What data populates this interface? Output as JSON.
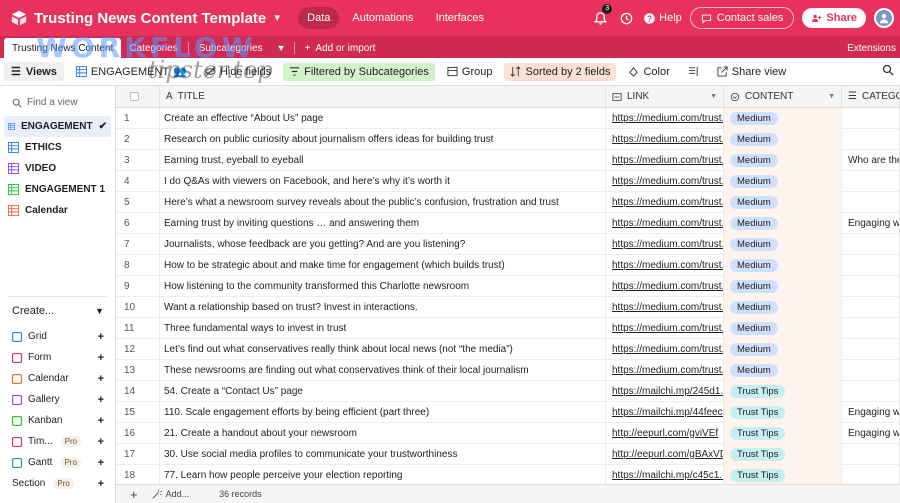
{
  "header": {
    "base_title": "Trusting News Content Template",
    "nav": [
      "Data",
      "Automations",
      "Interfaces"
    ],
    "notification_count": "3",
    "help_label": "Help",
    "contact_label": "Contact sales",
    "share_label": "Share"
  },
  "tables": {
    "tabs": [
      "Trusting News Content",
      "Categories",
      "Subcategories"
    ],
    "add_label": "Add or import",
    "extensions_label": "Extensions"
  },
  "watermark": {
    "line1": "WORKFLOW",
    "line2": "tipster.top"
  },
  "toolbar": {
    "views_label": "Views",
    "view_name": "ENGAGEMENT",
    "hide_fields": "Hide fields",
    "filter": "Filtered by Subcategories",
    "group": "Group",
    "sort": "Sorted by 2 fields",
    "color": "Color",
    "share_view": "Share view"
  },
  "sidebar": {
    "find_placeholder": "Find a view",
    "views": [
      {
        "label": "ENGAGEMENT",
        "color": "#2d7ff9"
      },
      {
        "label": "ETHICS",
        "color": "#2d7ff9"
      },
      {
        "label": "VIDEO",
        "color": "#8b46ff"
      },
      {
        "label": "ENGAGEMENT 1",
        "color": "#20c933"
      },
      {
        "label": "Calendar",
        "color": "#f7653b"
      }
    ],
    "create_label": "Create...",
    "create_items": [
      {
        "label": "Grid",
        "color": "#2d7ff9",
        "pro": ""
      },
      {
        "label": "Form",
        "color": "#e8315c",
        "pro": ""
      },
      {
        "label": "Calendar",
        "color": "#f7653b",
        "pro": ""
      },
      {
        "label": "Gallery",
        "color": "#8b46ff",
        "pro": ""
      },
      {
        "label": "Kanban",
        "color": "#20c933",
        "pro": ""
      },
      {
        "label": "Tim...",
        "color": "#e8315c",
        "pro": "Pro"
      },
      {
        "label": "Gantt",
        "color": "#11a1a1",
        "pro": "Pro"
      },
      {
        "label": "Section",
        "color": "",
        "pro": "Pro"
      }
    ]
  },
  "grid": {
    "columns": {
      "title": "TITLE",
      "link": "LINK",
      "content": "CONTENT",
      "category": "CATEGOR"
    },
    "rows": [
      {
        "n": "1",
        "title": "Create an effective “About Us” page",
        "link": "https://medium.com/trust...",
        "content": "Medium",
        "cat": ""
      },
      {
        "n": "2",
        "title": "Research on public curiosity about journalism offers ideas for building trust",
        "link": "https://medium.com/trust...",
        "content": "Medium",
        "cat": ""
      },
      {
        "n": "3",
        "title": "Earning trust, eyeball to eyeball",
        "link": "https://medium.com/trust...",
        "content": "Medium",
        "cat": "Who are the J..."
      },
      {
        "n": "4",
        "title": "I do Q&As with viewers on Facebook, and here’s why it’s worth it",
        "link": "https://medium.com/trust...",
        "content": "Medium",
        "cat": ""
      },
      {
        "n": "5",
        "title": "Here’s what a newsroom survey reveals about the public’s confusion, frustration and trust",
        "link": "https://medium.com/trust...",
        "content": "Medium",
        "cat": ""
      },
      {
        "n": "6",
        "title": "Earning trust by inviting questions … and answering them",
        "link": "https://medium.com/trust...",
        "content": "Medium",
        "cat": "Engaging with"
      },
      {
        "n": "7",
        "title": "Journalists, whose feedback are you getting? And are you listening?",
        "link": "https://medium.com/trust...",
        "content": "Medium",
        "cat": ""
      },
      {
        "n": "8",
        "title": "How to be strategic about and make time for engagement (which builds trust)",
        "link": "https://medium.com/trust...",
        "content": "Medium",
        "cat": ""
      },
      {
        "n": "9",
        "title": "How listening to the community transformed this Charlotte newsroom",
        "link": "https://medium.com/trust...",
        "content": "Medium",
        "cat": ""
      },
      {
        "n": "10",
        "title": "Want a relationship based on trust? Invest in interactions.",
        "link": "https://medium.com/trust...",
        "content": "Medium",
        "cat": ""
      },
      {
        "n": "11",
        "title": "Three fundamental ways to invest in trust",
        "link": "https://medium.com/trust...",
        "content": "Medium",
        "cat": ""
      },
      {
        "n": "12",
        "title": "Let’s find out what conservatives really think about local news (not “the media”)",
        "link": "https://medium.com/trust...",
        "content": "Medium",
        "cat": ""
      },
      {
        "n": "13",
        "title": "These newsrooms are finding out what conservatives think of their local journalism",
        "link": "https://medium.com/trust...",
        "content": "Medium",
        "cat": ""
      },
      {
        "n": "14",
        "title": "54. Create a “Contact Us” page",
        "link": "https://mailchi.mp/245d1...",
        "content": "Trust Tips",
        "cat": ""
      },
      {
        "n": "15",
        "title": "110. Scale engagement efforts by being efficient (part three)",
        "link": "https://mailchi.mp/44feec...",
        "content": "Trust Tips",
        "cat": "Engaging with"
      },
      {
        "n": "16",
        "title": "21. Create a handout about your newsroom",
        "link": "http://eepurl.com/gviVEf",
        "content": "Trust Tips",
        "cat": "Engaging with"
      },
      {
        "n": "17",
        "title": "30. Use social media profiles to communicate your trustworthiness",
        "link": "http://eepurl.com/gBAxVD",
        "content": "Trust Tips",
        "cat": ""
      },
      {
        "n": "18",
        "title": "77. Learn how people perceive your election reporting",
        "link": "https://mailchi.mp/c45c1...",
        "content": "Trust Tips",
        "cat": ""
      }
    ]
  },
  "footer": {
    "add_label": "Add...",
    "records": "36 records"
  },
  "colors": {
    "brand": "#e8315c",
    "brand_dark": "#d02a52",
    "tag_medium": "#cfe0fc",
    "tag_tips": "#c5eff0"
  }
}
